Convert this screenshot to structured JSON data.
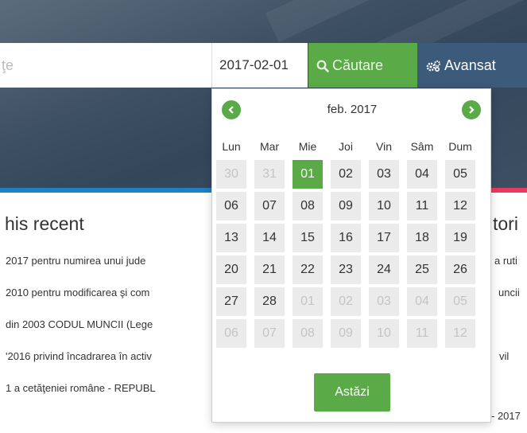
{
  "search": {
    "query_text": "ţe",
    "date_value": "2017-02-01",
    "search_button": "Căutare",
    "advanced_button": "Avansat"
  },
  "sections": {
    "left_heading": "his recent",
    "right_heading": "tori"
  },
  "left_items": [
    "2017 pentru numirea unui jude",
    "2010 pentru modificarea şi com",
    "din 2003 CODUL MUNCII (Lege",
    "'2016 privind încadrarea în activ",
    "1 a cetăţeniei române - REPUBL"
  ],
  "right_items": [
    "a ruti",
    "uncii",
    "vil",
    "- 2017"
  ],
  "datepicker": {
    "month_label": "feb. 2017",
    "weekdays": [
      "Lun",
      "Mar",
      "Mie",
      "Joi",
      "Vin",
      "Sâm",
      "Dum"
    ],
    "weeks": [
      [
        {
          "d": "30",
          "out": true
        },
        {
          "d": "31",
          "out": true
        },
        {
          "d": "01",
          "sel": true
        },
        {
          "d": "02"
        },
        {
          "d": "03"
        },
        {
          "d": "04"
        },
        {
          "d": "05"
        }
      ],
      [
        {
          "d": "06"
        },
        {
          "d": "07"
        },
        {
          "d": "08"
        },
        {
          "d": "09"
        },
        {
          "d": "10"
        },
        {
          "d": "11"
        },
        {
          "d": "12"
        }
      ],
      [
        {
          "d": "13"
        },
        {
          "d": "14"
        },
        {
          "d": "15"
        },
        {
          "d": "16"
        },
        {
          "d": "17"
        },
        {
          "d": "18"
        },
        {
          "d": "19"
        }
      ],
      [
        {
          "d": "20"
        },
        {
          "d": "21"
        },
        {
          "d": "22"
        },
        {
          "d": "23"
        },
        {
          "d": "24"
        },
        {
          "d": "25"
        },
        {
          "d": "26"
        }
      ],
      [
        {
          "d": "27"
        },
        {
          "d": "28"
        },
        {
          "d": "01",
          "out": true
        },
        {
          "d": "02",
          "out": true
        },
        {
          "d": "03",
          "out": true
        },
        {
          "d": "04",
          "out": true
        },
        {
          "d": "05",
          "out": true
        }
      ],
      [
        {
          "d": "06",
          "out": true
        },
        {
          "d": "07",
          "out": true
        },
        {
          "d": "08",
          "out": true
        },
        {
          "d": "09",
          "out": true
        },
        {
          "d": "10",
          "out": true
        },
        {
          "d": "11",
          "out": true
        },
        {
          "d": "12",
          "out": true
        }
      ]
    ],
    "today_button": "Astăzi"
  },
  "colors": {
    "accent_green": "#5aaa48",
    "advanced_blue": "#3c5a7a",
    "stripe_blue": "#1f7fc4",
    "stripe_red": "#e83a5c"
  },
  "icons": {
    "search_button": "search-icon",
    "advanced_button": "gears-icon",
    "prev": "chevron-left-icon",
    "next": "chevron-right-icon"
  }
}
